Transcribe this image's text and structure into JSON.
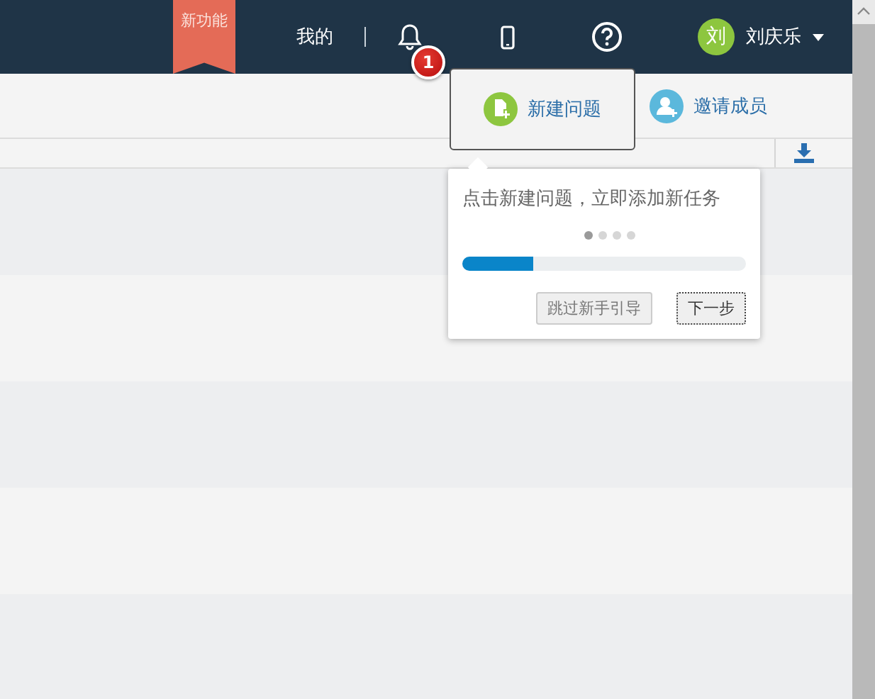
{
  "header": {
    "ribbon": "新功能",
    "nav_link": "我的",
    "notification_badge": "1",
    "user": {
      "avatar": "刘",
      "name": "刘庆乐"
    }
  },
  "action_bar": {
    "actions": [
      {
        "label": "新建问题",
        "kind": "new-issue",
        "highlighted": true
      },
      {
        "label": "邀请成员",
        "kind": "invite",
        "highlighted": false
      }
    ]
  },
  "guide": {
    "text": "点击新建问题，立即添加新任务",
    "steps": [
      {
        "selected": true
      },
      {
        "selected": false
      },
      {
        "selected": false
      },
      {
        "selected": false
      }
    ],
    "progress": {
      "level": 0.25
    },
    "buttons": [
      {
        "label": "跳过新手引导",
        "kind": "secondary"
      },
      {
        "label": "下一步",
        "kind": "primary"
      }
    ]
  }
}
